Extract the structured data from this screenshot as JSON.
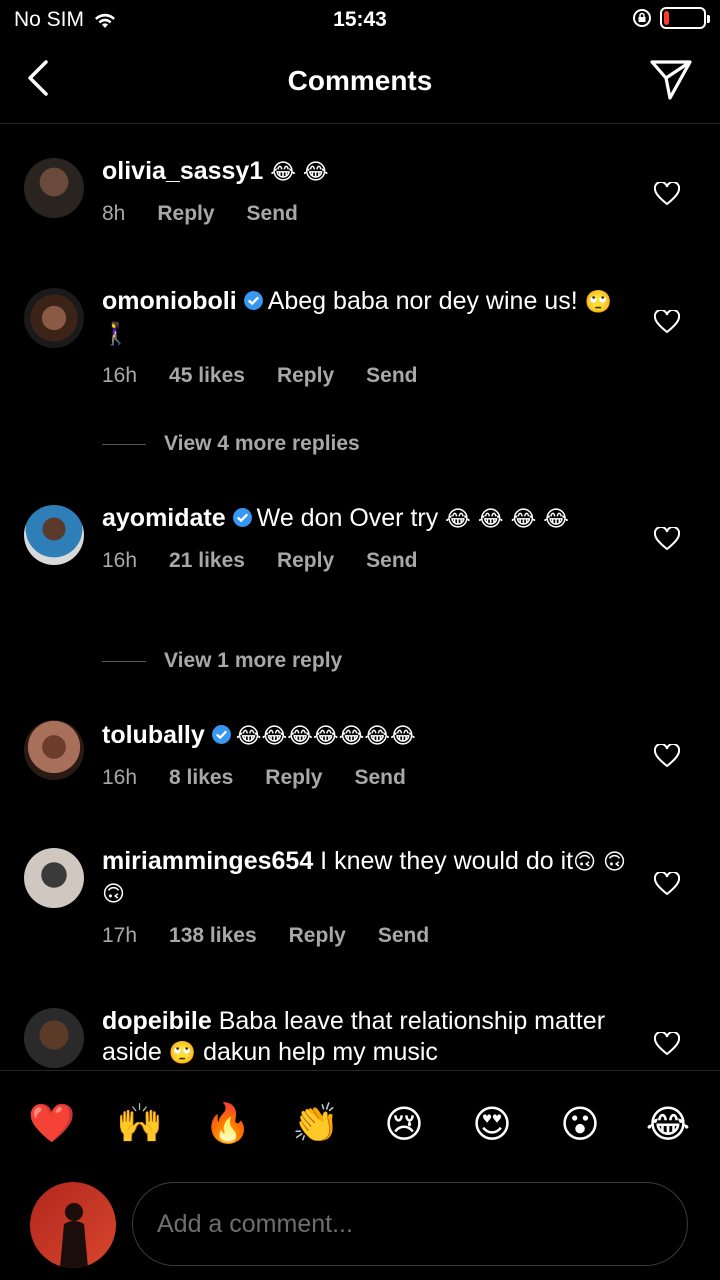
{
  "status_bar": {
    "carrier": "No SIM",
    "time": "15:43",
    "battery_level": 0.12,
    "battery_color": "#ff3b30"
  },
  "nav": {
    "title": "Comments",
    "back_icon": "chevron-left-icon",
    "share_icon": "paper-plane-icon"
  },
  "comments": [
    {
      "username": "olivia_sassy1",
      "verified": false,
      "text": "",
      "emoji": "😂 😂",
      "time": "8h",
      "likes": "",
      "reply": "Reply",
      "send": "Send"
    },
    {
      "username": "omonioboli",
      "verified": true,
      "text": "Abeg baba nor dey wine us!",
      "emoji": "🙄 🚶‍♀️",
      "time": "16h",
      "likes": "45 likes",
      "reply": "Reply",
      "send": "Send",
      "view_replies": "View 4 more replies"
    },
    {
      "username": "ayomidate",
      "verified": true,
      "text": "We don Over try",
      "emoji": "😂 😂 😂 😂",
      "time": "16h",
      "likes": "21 likes",
      "reply": "Reply",
      "send": "Send",
      "view_replies": "View 1 more reply"
    },
    {
      "username": "tolubally",
      "verified": true,
      "text": "",
      "emoji": "😂😂😂😂😂😂😂",
      "time": "16h",
      "likes": "8 likes",
      "reply": "Reply",
      "send": "Send"
    },
    {
      "username": "miriamminges654",
      "verified": false,
      "text": "I knew they would do it",
      "emoji": "🙃 🙃 🙃",
      "time": "17h",
      "likes": "138 likes",
      "reply": "Reply",
      "send": "Send"
    },
    {
      "username": "dopeibile",
      "verified": false,
      "text": "Baba leave that relationship matter aside",
      "emoji": "🙄",
      "text2": "dakun help my music",
      "time": "",
      "likes": "",
      "reply": "",
      "send": ""
    }
  ],
  "reactions": [
    "❤️",
    "🙌",
    "🔥",
    "👏",
    "😢",
    "😍",
    "😮",
    "😂"
  ],
  "composer": {
    "placeholder": "Add a comment..."
  },
  "colors": {
    "verified": "#3897f0",
    "muted": "#a8a8a8"
  }
}
